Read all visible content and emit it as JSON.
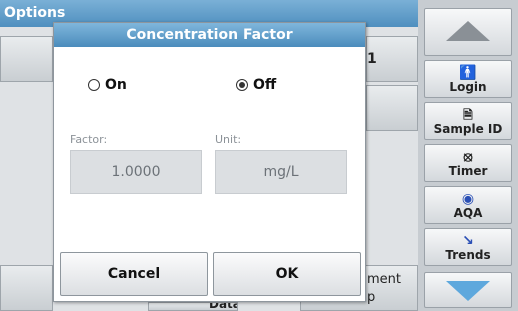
{
  "app": {
    "title": "Options",
    "partial_button_text_1": "1",
    "bottom_buttons": [
      {
        "lines": [
          "ment",
          "p"
        ]
      },
      {
        "lines": [
          "Data"
        ]
      }
    ]
  },
  "side_panel": {
    "items": [
      {
        "label": "Login",
        "icon": "person-icon"
      },
      {
        "label": "Sample ID",
        "icon": "sample-icon"
      },
      {
        "label": "Timer",
        "icon": "timer-icon"
      },
      {
        "label": "AQA",
        "icon": "aqa-icon"
      },
      {
        "label": "Trends",
        "icon": "trends-icon"
      }
    ],
    "accent_color": "#5ea8dd"
  },
  "dialog": {
    "title": "Concentration Factor",
    "options": [
      {
        "label": "On",
        "selected": false
      },
      {
        "label": "Off",
        "selected": true
      }
    ],
    "factor": {
      "label": "Factor:",
      "value": "1.0000"
    },
    "unit": {
      "label": "Unit:",
      "value": "mg/L"
    },
    "cancel_label": "Cancel",
    "ok_label": "OK"
  },
  "colors": {
    "title_bar": "#4f8fbf",
    "disabled_field": "#dcdfe2"
  }
}
